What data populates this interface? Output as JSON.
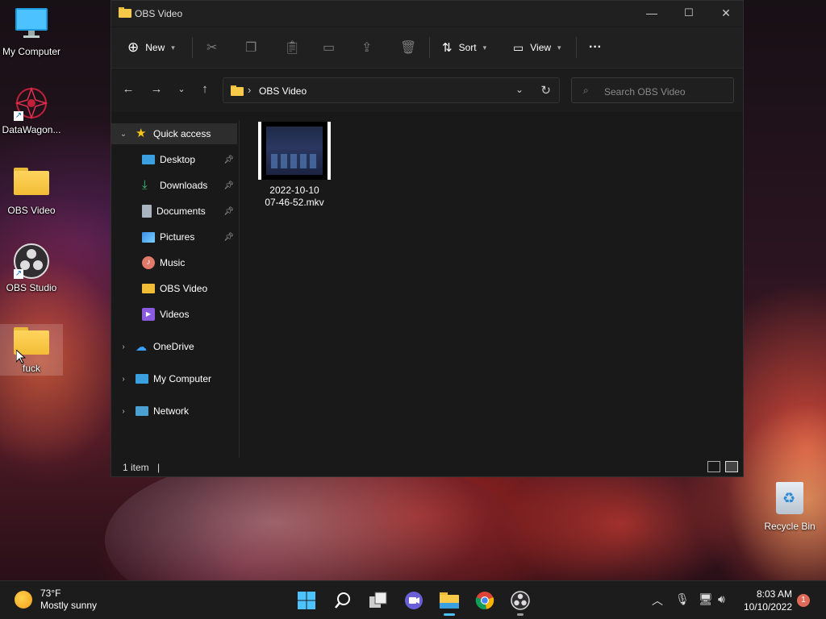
{
  "desktop": {
    "icons": [
      {
        "label": "My Computer"
      },
      {
        "label": "DataWagon..."
      },
      {
        "label": "OBS Video"
      },
      {
        "label": "OBS Studio"
      },
      {
        "label": "fuck"
      }
    ],
    "recycle_bin": {
      "label": "Recycle Bin"
    }
  },
  "window": {
    "title": "OBS Video",
    "controls": {
      "minimize": "—",
      "maximize": "☐",
      "close": "✕"
    },
    "toolbar": {
      "new_label": "New",
      "sort_label": "Sort",
      "view_label": "View",
      "more_label": "···"
    },
    "address": {
      "path": "OBS Video"
    },
    "search": {
      "placeholder": "Search OBS Video"
    },
    "sidebar": {
      "items": [
        {
          "label": "Quick access"
        },
        {
          "label": "Desktop"
        },
        {
          "label": "Downloads"
        },
        {
          "label": "Documents"
        },
        {
          "label": "Pictures"
        },
        {
          "label": "Music"
        },
        {
          "label": "OBS Video"
        },
        {
          "label": "Videos"
        },
        {
          "label": "OneDrive"
        },
        {
          "label": "My Computer"
        },
        {
          "label": "Network"
        }
      ]
    },
    "files": [
      {
        "name_line1": "2022-10-10",
        "name_line2": "07-46-52.mkv"
      }
    ],
    "status": {
      "count": "1 item"
    }
  },
  "taskbar": {
    "weather": {
      "temp": "73°F",
      "condition": "Mostly sunny"
    },
    "clock": {
      "time": "8:03 AM",
      "date": "10/10/2022"
    },
    "notifications": "1"
  },
  "colors": {
    "accent": "#4cc2ff",
    "folder": "#f2bd36",
    "window_bg": "#191919"
  }
}
